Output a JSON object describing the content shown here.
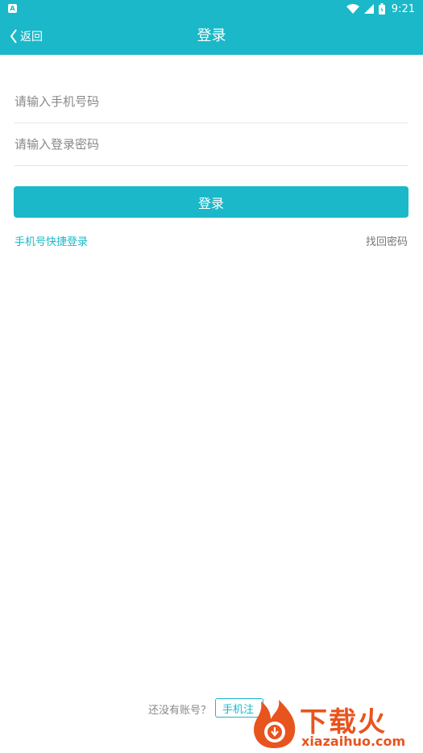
{
  "status_bar": {
    "app_icon": "A",
    "time": "9:21",
    "icons": [
      "wifi-icon",
      "cellular-signal-icon",
      "battery-icon"
    ]
  },
  "header": {
    "back_label": "返回",
    "title": "登录",
    "background_color": "#1ab8c8"
  },
  "form": {
    "phone_placeholder": "请输入手机号码",
    "phone_value": "",
    "password_placeholder": "请输入登录密码",
    "password_value": "",
    "login_button": "登录"
  },
  "links": {
    "quick_login": "手机号快捷登录",
    "find_password": "找回密码"
  },
  "footer": {
    "no_account": "还没有账号？",
    "register_button": "手机注"
  },
  "watermark": {
    "title": "下载火",
    "domain": "xiazaihuo.com"
  },
  "colors": {
    "accent": "#1ab8c8",
    "watermark": "#e8541e"
  }
}
